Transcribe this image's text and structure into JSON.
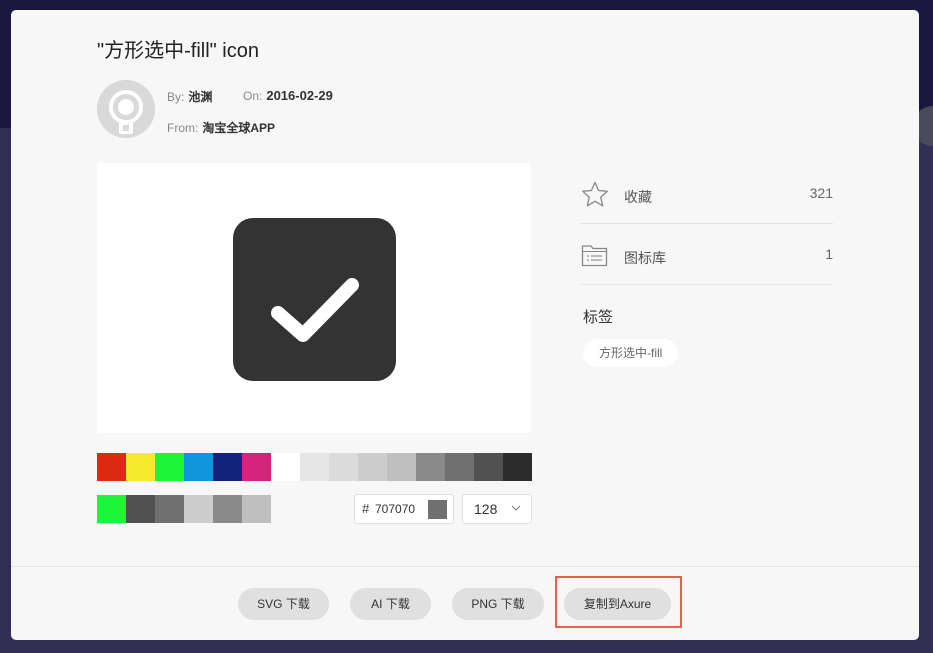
{
  "icon": {
    "title": "\"方形选中-fill\" icon",
    "by_label": "By:",
    "author": "池渊",
    "on_label": "On:",
    "date": "2016-02-29",
    "from_label": "From:",
    "source": "淘宝全球APP",
    "icon_color": "#333333"
  },
  "palette_row1": [
    "#dd2a13",
    "#f5ea2e",
    "#1ef43a",
    "#1296db",
    "#13227a",
    "#d4237a",
    "#ffffff",
    "#e6e6e6",
    "#dbdbdb",
    "#cdcdcd",
    "#bfbfbf",
    "#8a8a8a",
    "#707070",
    "#515151",
    "#2c2c2c"
  ],
  "palette_row2": [
    "#1ef43a",
    "#515151",
    "#707070",
    "#cdcdcd",
    "#8a8a8a",
    "#bfbfbf"
  ],
  "color_picker": {
    "hash": "#",
    "value": "707070",
    "swatch": "#707070"
  },
  "size_select": {
    "value": "128"
  },
  "stats": {
    "favorites_label": "收藏",
    "favorites_count": "321",
    "library_label": "图标库",
    "library_count": "1"
  },
  "tags": {
    "heading": "标签",
    "items": [
      "方形选中-fill"
    ]
  },
  "buttons": {
    "svg": "SVG 下载",
    "ai": "AI 下载",
    "png": "PNG 下载",
    "axure": "复制到Axure"
  },
  "colors": {
    "highlight": "#e8604c"
  }
}
